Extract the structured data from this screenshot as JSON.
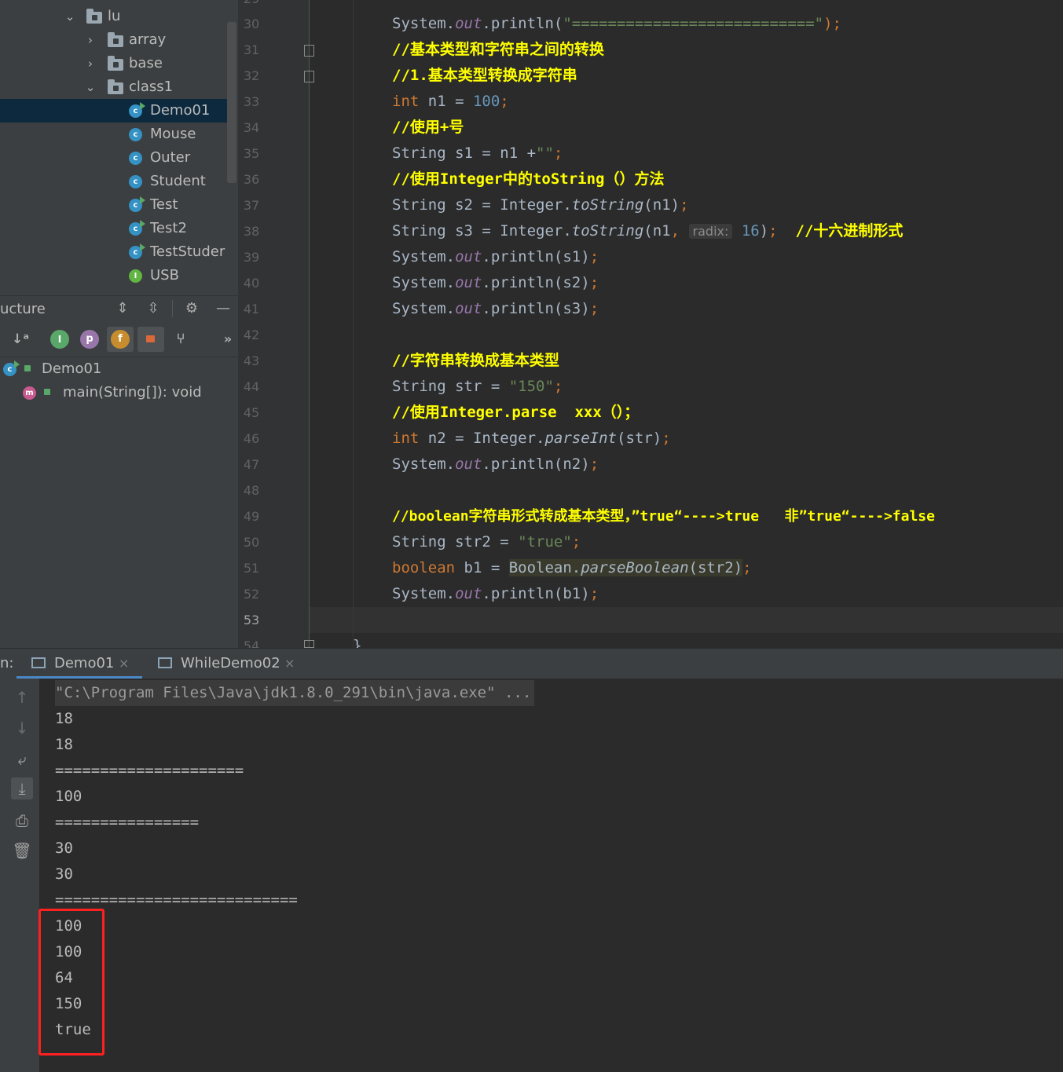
{
  "project_tree": {
    "items": [
      {
        "label": "lu",
        "kind": "folder",
        "expanded": true
      },
      {
        "label": "array",
        "kind": "folder",
        "expanded": false
      },
      {
        "label": "base",
        "kind": "folder",
        "expanded": false
      },
      {
        "label": "class1",
        "kind": "folder",
        "expanded": true
      },
      {
        "label": "Demo01",
        "kind": "class-runnable",
        "selected": true
      },
      {
        "label": "Mouse",
        "kind": "class"
      },
      {
        "label": "Outer",
        "kind": "class"
      },
      {
        "label": "Student",
        "kind": "class"
      },
      {
        "label": "Test",
        "kind": "class-runnable"
      },
      {
        "label": "Test2",
        "kind": "class-runnable"
      },
      {
        "label": "TestStuder",
        "kind": "class-runnable"
      },
      {
        "label": "USB",
        "kind": "interface"
      }
    ],
    "icon_letters": {
      "class": "c",
      "interface": "I"
    }
  },
  "structure": {
    "title": "ucture",
    "toolbar_letters": {
      "inherited": "I",
      "property": "p",
      "field": "f"
    },
    "class_name": "Demo01",
    "method_badge": "m",
    "method_signature": "main(String[]): void"
  },
  "editor": {
    "first_line_number": 30,
    "current_line": 53,
    "line_numbers": [
      "30",
      "31",
      "32",
      "33",
      "34",
      "35",
      "36",
      "37",
      "38",
      "39",
      "40",
      "41",
      "42",
      "43",
      "44",
      "45",
      "46",
      "47",
      "48",
      "49",
      "50",
      "51",
      "52",
      "53"
    ],
    "partial_top_line": "29",
    "partial_bottom_line": "54",
    "code": {
      "l30": {
        "a": "System.",
        "b": "out",
        "c": ".println(",
        "d": "\"===========================\"",
        "e": ");"
      },
      "l31": "//基本类型和字符串之间的转换",
      "l32": "//1.基本类型转换成字符串",
      "l33": {
        "a": "int",
        "b": " n1 = ",
        "c": "100",
        "d": ";"
      },
      "l34": "//使用+号",
      "l35": {
        "a": "String s1 = n1 +",
        "b": "\"\"",
        "c": ";"
      },
      "l36": "//使用Integer中的toString（）方法",
      "l37": {
        "a": "String s2 = Integer.",
        "b": "toString",
        "c": "(n1)",
        "d": ";"
      },
      "l38": {
        "a": "String s3 = Integer.",
        "b": "toString",
        "c": "(n1",
        "d": ",",
        "hint": "radix:",
        "e": "16",
        "f": ")",
        "g": ";",
        "comment": "//十六进制形式"
      },
      "l39": {
        "a": "System.",
        "b": "out",
        "c": ".println(s1)",
        "d": ";"
      },
      "l40": {
        "a": "System.",
        "b": "out",
        "c": ".println(s2)",
        "d": ";"
      },
      "l41": {
        "a": "System.",
        "b": "out",
        "c": ".println(s3)",
        "d": ";"
      },
      "l43": "//字符串转换成基本类型",
      "l44": {
        "a": "String str = ",
        "b": "\"150\"",
        "c": ";"
      },
      "l45": "//使用Integer.parse  xxx（）；",
      "l46": {
        "a": "int",
        "b": " n2 = Integer.",
        "c": "parseInt",
        "d": "(str)",
        "e": ";"
      },
      "l47": {
        "a": "System.",
        "b": "out",
        "c": ".println(n2)",
        "d": ";"
      },
      "l49": "//boolean字符串形式转成基本类型，”true“---->true   非”true“---->false",
      "l50": {
        "a": "String str2 = ",
        "b": "\"true\"",
        "c": ";"
      },
      "l51": {
        "a": "boolean",
        "b": " b1 = ",
        "c": "Boolean.",
        "d": "parseBoolean",
        "e": "(str2)",
        "f": ";"
      },
      "l52": {
        "a": "System.",
        "b": "out",
        "c": ".println(b1)",
        "d": ";"
      },
      "l54": "}"
    }
  },
  "run_panel": {
    "label": "n:",
    "tabs": [
      {
        "label": "Demo01",
        "active": true
      },
      {
        "label": "WhileDemo02",
        "active": false
      }
    ],
    "close_glyph": "×",
    "command_line": "\"C:\\Program Files\\Java\\jdk1.8.0_291\\bin\\java.exe\" ...",
    "output_lines": [
      "18",
      "18",
      "=====================",
      "100",
      "================",
      "30",
      "30",
      "===========================",
      "100",
      "100",
      "64",
      "150",
      "true"
    ]
  },
  "colors": {
    "keyword": "#cc7832",
    "number": "#6897bb",
    "string": "#6a8759",
    "field": "#9876aa",
    "comment_highlight": "#ffff00",
    "selection": "#0d293e",
    "annotation_box": "#ff2020"
  }
}
